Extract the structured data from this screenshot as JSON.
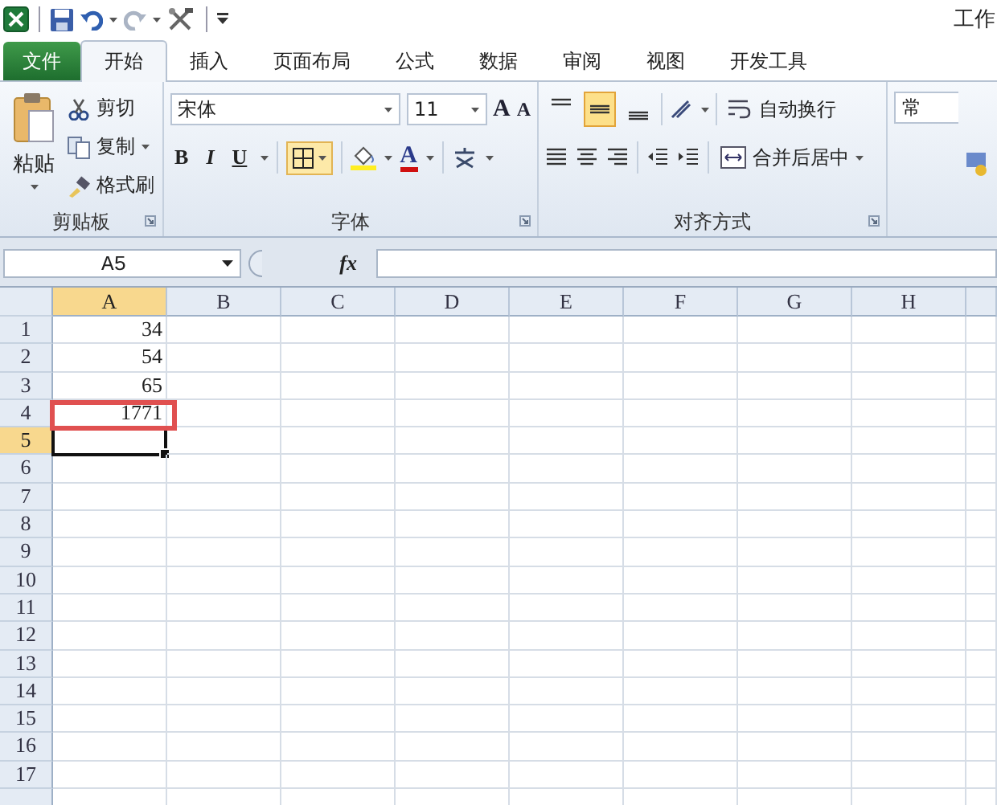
{
  "window": {
    "title": "工作"
  },
  "tabs": [
    {
      "label": "文件",
      "kind": "file",
      "selected": false
    },
    {
      "label": "开始",
      "kind": "tab",
      "selected": true
    },
    {
      "label": "插入",
      "kind": "tab",
      "selected": false
    },
    {
      "label": "页面布局",
      "kind": "tab",
      "selected": false
    },
    {
      "label": "公式",
      "kind": "tab",
      "selected": false
    },
    {
      "label": "数据",
      "kind": "tab",
      "selected": false
    },
    {
      "label": "审阅",
      "kind": "tab",
      "selected": false
    },
    {
      "label": "视图",
      "kind": "tab",
      "selected": false
    },
    {
      "label": "开发工具",
      "kind": "tab",
      "selected": false
    }
  ],
  "clipboard": {
    "paste": "粘贴",
    "cut": "剪切",
    "copy": "复制",
    "format_painter": "格式刷",
    "label": "剪贴板"
  },
  "font": {
    "name": "宋体",
    "size": "11",
    "grow": "A",
    "shrink": "A",
    "bold": "B",
    "italic": "I",
    "underline": "U",
    "borders_selected": true,
    "font_color": "A",
    "label": "字体"
  },
  "alignment": {
    "vertical": [
      {
        "kind": "top",
        "selected": false
      },
      {
        "kind": "middle",
        "selected": true
      },
      {
        "kind": "bottom",
        "selected": false
      }
    ],
    "wrap": "自动换行",
    "merge": "合并后居中",
    "label": "对齐方式"
  },
  "number": {
    "format": "常"
  },
  "formula_bar": {
    "name_box": "A5",
    "fx": "fx"
  },
  "sheet": {
    "columns": [
      {
        "label": "A",
        "selected": true
      },
      {
        "label": "B",
        "selected": false
      },
      {
        "label": "C",
        "selected": false
      },
      {
        "label": "D",
        "selected": false
      },
      {
        "label": "E",
        "selected": false
      },
      {
        "label": "F",
        "selected": false
      },
      {
        "label": "G",
        "selected": false
      },
      {
        "label": "H",
        "selected": false
      }
    ],
    "rows": [
      {
        "label": "1",
        "selected": false,
        "cells": [
          {
            "value": "34",
            "active": false,
            "highlighted": false
          }
        ]
      },
      {
        "label": "2",
        "selected": false,
        "cells": [
          {
            "value": "54",
            "active": false,
            "highlighted": false
          }
        ]
      },
      {
        "label": "3",
        "selected": false,
        "cells": [
          {
            "value": "65",
            "active": false,
            "highlighted": false
          }
        ]
      },
      {
        "label": "4",
        "selected": false,
        "cells": [
          {
            "value": "1771",
            "active": false,
            "highlighted": true
          }
        ]
      },
      {
        "label": "5",
        "selected": true,
        "cells": [
          {
            "active": true,
            "highlighted": false
          }
        ]
      },
      {
        "label": "6",
        "selected": false,
        "cells": []
      },
      {
        "label": "7",
        "selected": false,
        "cells": []
      },
      {
        "label": "8",
        "selected": false,
        "cells": []
      },
      {
        "label": "9",
        "selected": false,
        "cells": []
      },
      {
        "label": "10",
        "selected": false,
        "cells": []
      },
      {
        "label": "11",
        "selected": false,
        "cells": []
      },
      {
        "label": "12",
        "selected": false,
        "cells": []
      },
      {
        "label": "13",
        "selected": false,
        "cells": []
      },
      {
        "label": "14",
        "selected": false,
        "cells": []
      },
      {
        "label": "15",
        "selected": false,
        "cells": []
      },
      {
        "label": "16",
        "selected": false,
        "cells": []
      },
      {
        "label": "17",
        "selected": false,
        "cells": []
      }
    ]
  }
}
